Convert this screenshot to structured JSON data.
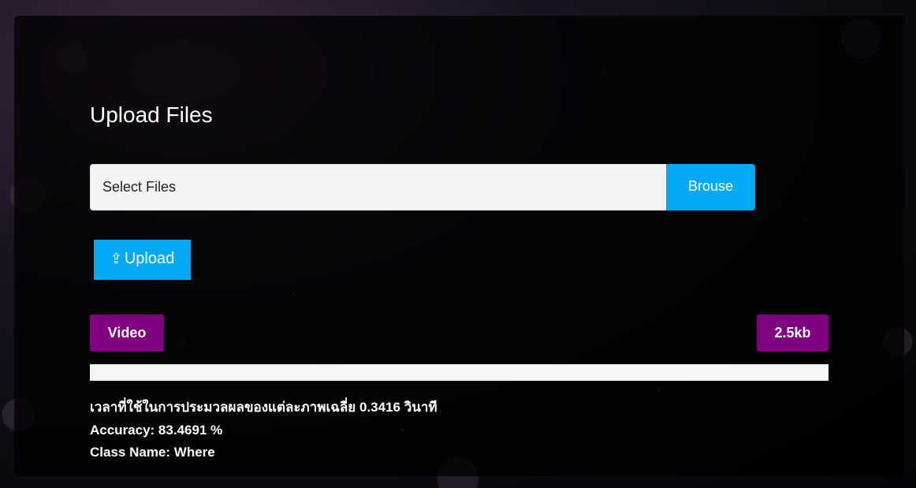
{
  "upload": {
    "title": "Upload Files",
    "input_placeholder": "Select Files",
    "browse_label": "Brouse",
    "upload_icon": "⇪",
    "upload_label": "Upload"
  },
  "file_info": {
    "type_label": "Video",
    "size_label": "2.5kb",
    "progress": 0
  },
  "results": {
    "time_text": "เวลาที่ใช้ในการประมวลผลของแต่ละภาพเฉลี่ย 0.3416 วินาที",
    "accuracy_text": "Accuracy: 83.4691 %",
    "class_text": "Class Name: Where"
  },
  "colors": {
    "accent": "#03a9f4",
    "badge": "#800080",
    "panel": "rgba(0,0,0,0.74)"
  }
}
